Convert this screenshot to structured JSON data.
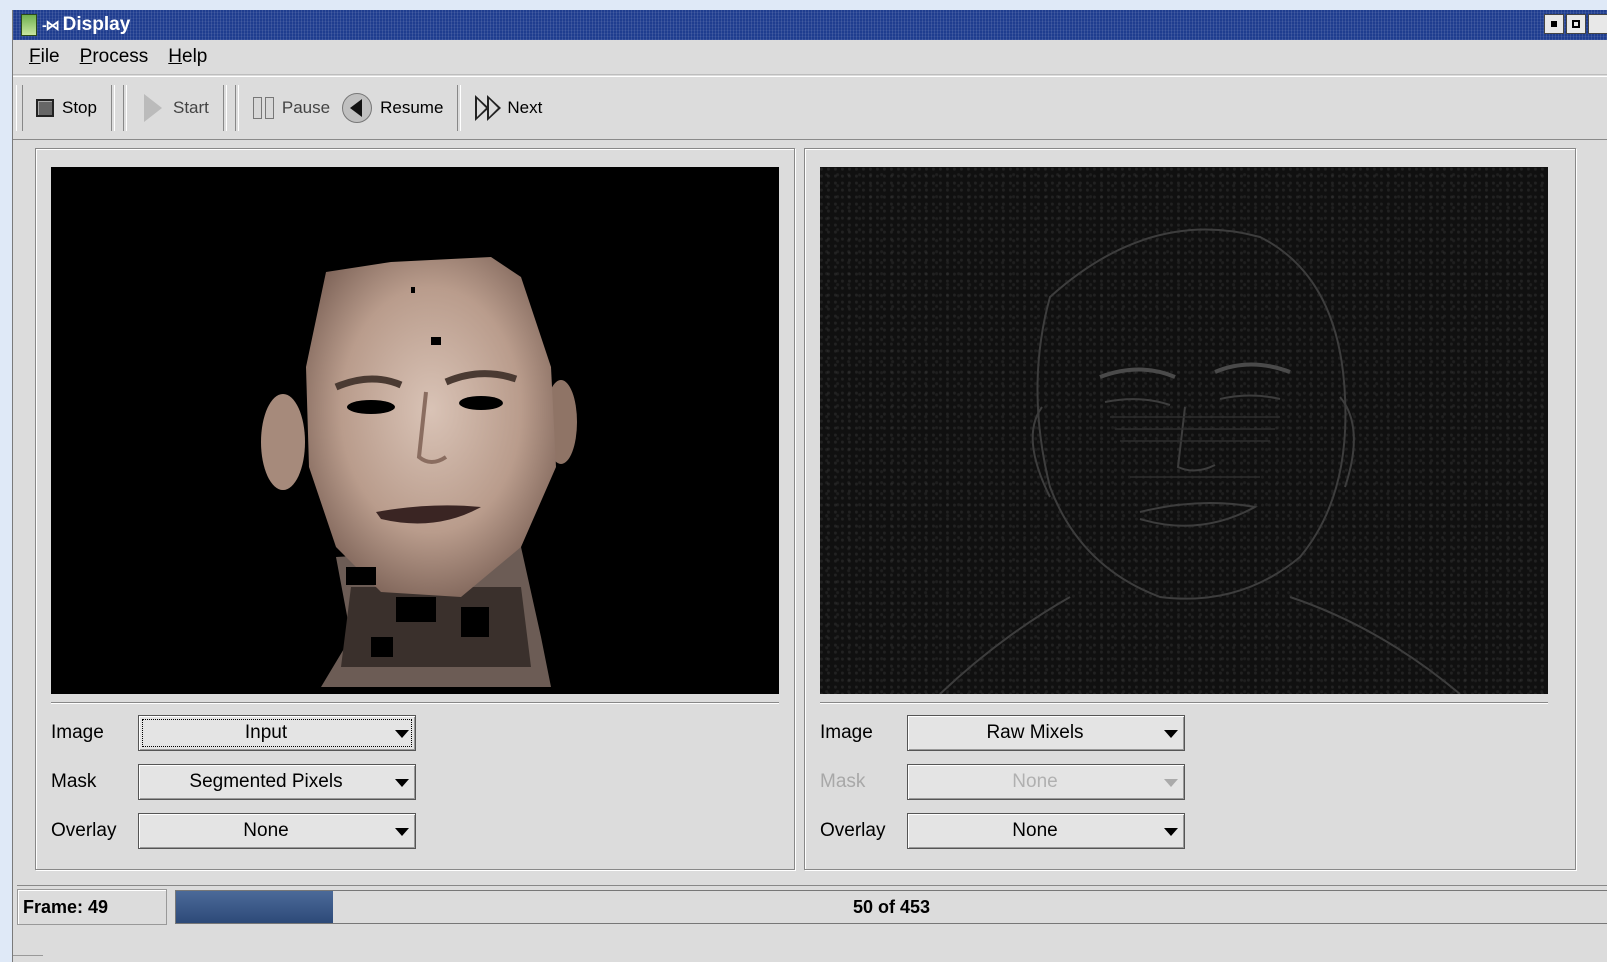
{
  "window": {
    "title": "Display",
    "pin_icon": "-⋈",
    "controls": [
      "minimize-icon",
      "maximize-icon",
      "close-icon"
    ]
  },
  "menu": {
    "items": [
      {
        "mnemonic": "F",
        "rest": "ile"
      },
      {
        "mnemonic": "P",
        "rest": "rocess"
      },
      {
        "mnemonic": "H",
        "rest": "elp"
      }
    ]
  },
  "toolbar": {
    "stop_label": "Stop",
    "start_label": "Start",
    "pause_label": "Pause",
    "resume_label": "Resume",
    "next_label": "Next"
  },
  "left_panel": {
    "image_label": "Image",
    "image_value": "Input",
    "mask_label": "Mask",
    "mask_value": "Segmented Pixels",
    "overlay_label": "Overlay",
    "overlay_value": "None"
  },
  "right_panel": {
    "image_label": "Image",
    "image_value": "Raw Mixels",
    "mask_label": "Mask",
    "mask_value": "None",
    "overlay_label": "Overlay",
    "overlay_value": "None"
  },
  "status": {
    "frame_label": "Frame: 49",
    "progress_text": "50 of 453",
    "progress_fraction": 0.11
  },
  "colors": {
    "titlebar": "#1f3d8f",
    "progress_fill": "#3a5686",
    "window_bg": "#dcdcdc"
  }
}
